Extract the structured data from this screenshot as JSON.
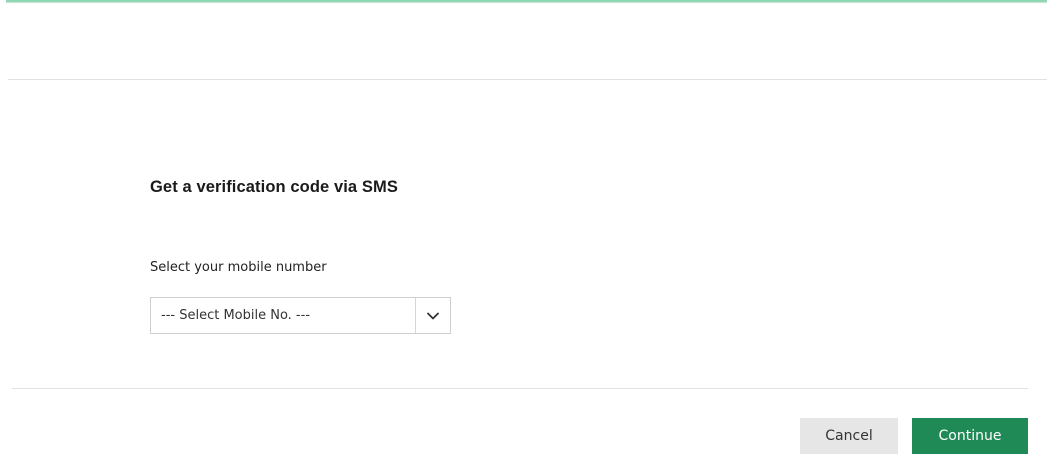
{
  "dialog": {
    "title": "Get a verification code via SMS",
    "mobile_label": "Select your mobile number",
    "mobile_select": {
      "selected": "--- Select Mobile No. ---",
      "icon": "chevron-down-icon"
    },
    "actions": {
      "cancel_label": "Cancel",
      "continue_label": "Continue"
    }
  },
  "colors": {
    "accent": "#1f8a55",
    "top_accent_line": "#8fd6b4",
    "cancel_bg": "#e6e6e6",
    "divider": "#e2e2e2"
  }
}
